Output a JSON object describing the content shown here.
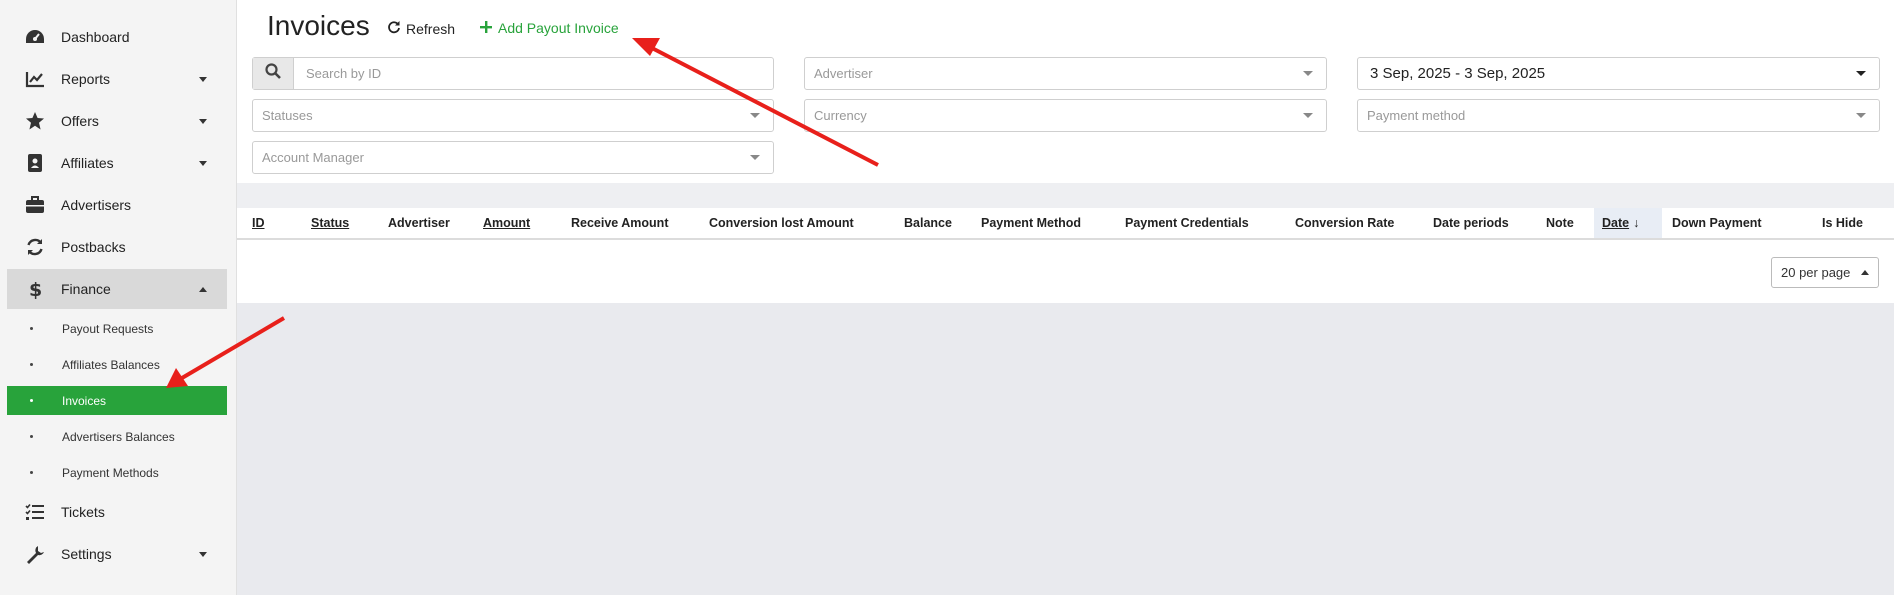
{
  "sidebar": {
    "items": [
      {
        "label": "Dashboard",
        "icon": "dashboard-icon"
      },
      {
        "label": "Reports",
        "icon": "chart-line-icon"
      },
      {
        "label": "Offers",
        "icon": "star-icon"
      },
      {
        "label": "Affiliates",
        "icon": "id-card-icon"
      },
      {
        "label": "Advertisers",
        "icon": "briefcase-icon"
      },
      {
        "label": "Postbacks",
        "icon": "sync-icon"
      },
      {
        "label": "Finance",
        "icon": "dollar-icon"
      },
      {
        "label": "Tickets",
        "icon": "list-check-icon"
      },
      {
        "label": "Settings",
        "icon": "wrench-icon"
      }
    ],
    "finance_sub": [
      {
        "label": "Payout Requests"
      },
      {
        "label": "Affiliates Balances"
      },
      {
        "label": "Invoices"
      },
      {
        "label": "Advertisers Balances"
      },
      {
        "label": "Payment Methods"
      }
    ]
  },
  "header": {
    "title": "Invoices",
    "refresh_label": "Refresh",
    "add_label": "Add Payout Invoice"
  },
  "filters": {
    "search_placeholder": "Search by ID",
    "advertiser_placeholder": "Advertiser",
    "date_range": "3 Sep, 2025 - 3 Sep, 2025",
    "statuses_placeholder": "Statuses",
    "currency_placeholder": "Currency",
    "payment_method_placeholder": "Payment method",
    "account_manager_placeholder": "Account Manager"
  },
  "table": {
    "columns": [
      "ID",
      "Status",
      "Advertiser",
      "Amount",
      "Receive Amount",
      "Conversion lost Amount",
      "Balance",
      "Payment Method",
      "Payment Credentials",
      "Conversion Rate",
      "Date periods",
      "Note",
      "Date",
      "Down Payment",
      "Is Hide"
    ],
    "sort_indicator": "↓",
    "per_page": "20 per page"
  },
  "colors": {
    "accent": "#28a33b",
    "annotation_arrow": "#e8201b"
  }
}
